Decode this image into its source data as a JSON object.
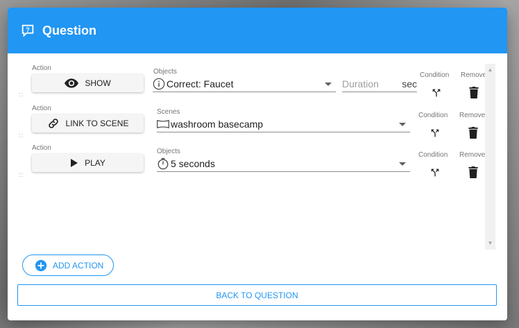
{
  "dialog": {
    "title": "Question",
    "header_icon": "help-box-icon",
    "accent_color": "#2196f3"
  },
  "column_labels": {
    "action": "Action",
    "condition": "Condition",
    "remove": "Remove"
  },
  "rows": [
    {
      "action_label": "SHOW",
      "action_icon": "eye-icon",
      "field_label": "Objects",
      "field_icon": "info-icon",
      "field_value": "Correct: Faucet",
      "duration_placeholder": "Duration",
      "duration_unit": "sec"
    },
    {
      "action_label": "LINK TO SCENE",
      "action_icon": "link-icon",
      "field_label": "Scenes",
      "field_icon": "panorama-icon",
      "field_value": "washroom basecamp"
    },
    {
      "action_label": "PLAY",
      "action_icon": "play-icon",
      "field_label": "Objects",
      "field_icon": "timer-icon",
      "field_value": "5 seconds"
    }
  ],
  "add_action_label": "ADD ACTION",
  "back_label": "BACK TO QUESTION"
}
